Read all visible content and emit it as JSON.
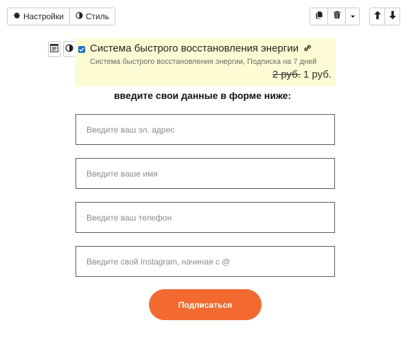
{
  "toolbar": {
    "settings_label": "Настройки",
    "style_label": "Стиль"
  },
  "product": {
    "checked": true,
    "title": "Система быстрого восстановления энергии",
    "subtitle": "Система быстрого восстановления энергии, Подписка на 7 дней",
    "old_price": "2 руб.",
    "new_price": "1 руб."
  },
  "form": {
    "heading": "введите свои данные в форме ниже:",
    "email_placeholder": "Введите ваш эл. адрес",
    "name_placeholder": "Введите ваше имя",
    "phone_placeholder": "Введите ваш телефон",
    "instagram_placeholder": "Введите свой Instagram, начиная с @",
    "submit_label": "Подписаться"
  },
  "colors": {
    "accent": "#f26a2f",
    "product_bg": "#fdfbd3",
    "checkbox": "#1a6dd6"
  }
}
